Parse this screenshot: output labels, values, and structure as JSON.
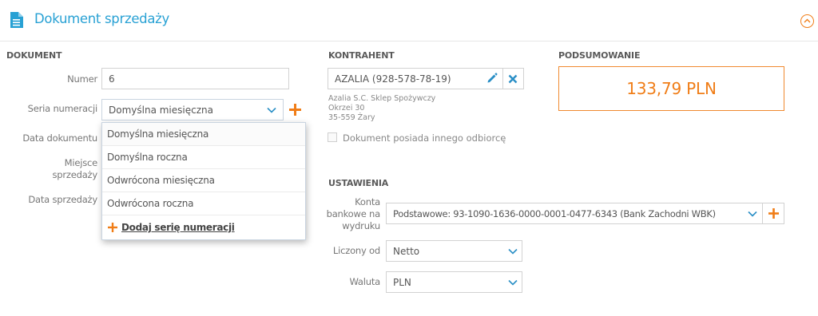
{
  "header": {
    "title": "Dokument sprzedaży"
  },
  "dokument": {
    "section_label": "DOKUMENT",
    "numer_label": "Numer",
    "numer_value": "6",
    "seria_label": "Seria numeracji",
    "seria_value": "Domyślna miesięczna",
    "data_dokumentu_label": "Data dokumentu",
    "miejsce_label_line1": "Miejsce",
    "miejsce_label_line2": "sprzedaży",
    "data_sprzedazy_label": "Data sprzedaży"
  },
  "dropdown": {
    "options": [
      "Domyślna miesięczna",
      "Domyślna roczna",
      "Odwrócona miesięczna",
      "Odwrócona roczna"
    ],
    "add_label": "Dodaj serię numeracji"
  },
  "kontrahent": {
    "section_label": "KONTRAHENT",
    "value": "AZALIA (928-578-78-19)",
    "details": [
      "Azalia S.C. Sklep Spożywczy",
      "Okrzei 30",
      "35-559 Żary"
    ],
    "other_recipient_label": "Dokument posiada innego odbiorcę"
  },
  "podsumowanie": {
    "section_label": "PODSUMOWANIE",
    "total": "133,79 PLN"
  },
  "ustawienia": {
    "section_label": "USTAWIENIA",
    "konta_label_line1": "Konta",
    "konta_label_line2": "bankowe na",
    "konta_label_line3": "wydruku",
    "konta_value": "Podstawowe: 93-1090-1636-0000-0001-0477-6343 (Bank Zachodni WBK)",
    "liczony_label": "Liczony od",
    "liczony_value": "Netto",
    "waluta_label": "Waluta",
    "waluta_value": "PLN"
  },
  "icons": {
    "document": "document-icon",
    "collapse": "chevron-up-circle-icon",
    "edit": "pencil-icon",
    "remove": "close-icon",
    "add": "plus-icon",
    "dropdown": "chevron-down-icon"
  },
  "colors": {
    "accent_blue": "#28a1d4",
    "accent_orange": "#f07d17",
    "border": "#d2d2d2"
  }
}
